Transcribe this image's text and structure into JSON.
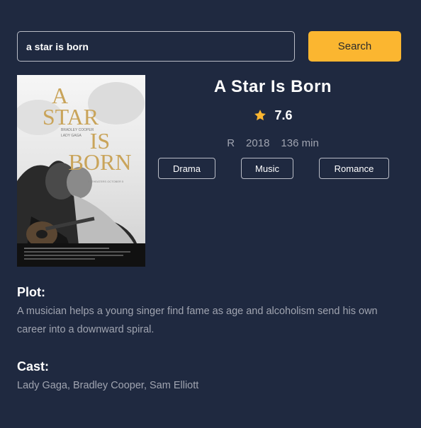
{
  "search": {
    "value": "a star is born",
    "placeholder": "",
    "button_label": "Search"
  },
  "movie": {
    "title": "A Star Is Born",
    "rating": "7.6",
    "rated": "R",
    "year": "2018",
    "runtime": "136 min",
    "genres": [
      "Drama",
      "Music",
      "Romance"
    ],
    "poster_text": {
      "line1": "A",
      "line2": "STAR",
      "line3": "IS",
      "line4": "BORN",
      "credit1": "BRADLEY COOPER",
      "credit2": "LADY GAGA",
      "tagline": "IN THEATERS OCTOBER 5"
    }
  },
  "plot": {
    "heading": "Plot:",
    "text": "A musician helps a young singer find fame as age and alcoholism send his own career into a downward spiral."
  },
  "cast": {
    "heading": "Cast:",
    "text": "Lady Gaga, Bradley Cooper, Sam Elliott"
  },
  "colors": {
    "background": "#1f2940",
    "accent": "#fbb630",
    "star": "#fbb630",
    "muted_text": "#a0a4b0",
    "border": "#b9bcc6"
  },
  "icons": {
    "rating": "star-icon"
  }
}
